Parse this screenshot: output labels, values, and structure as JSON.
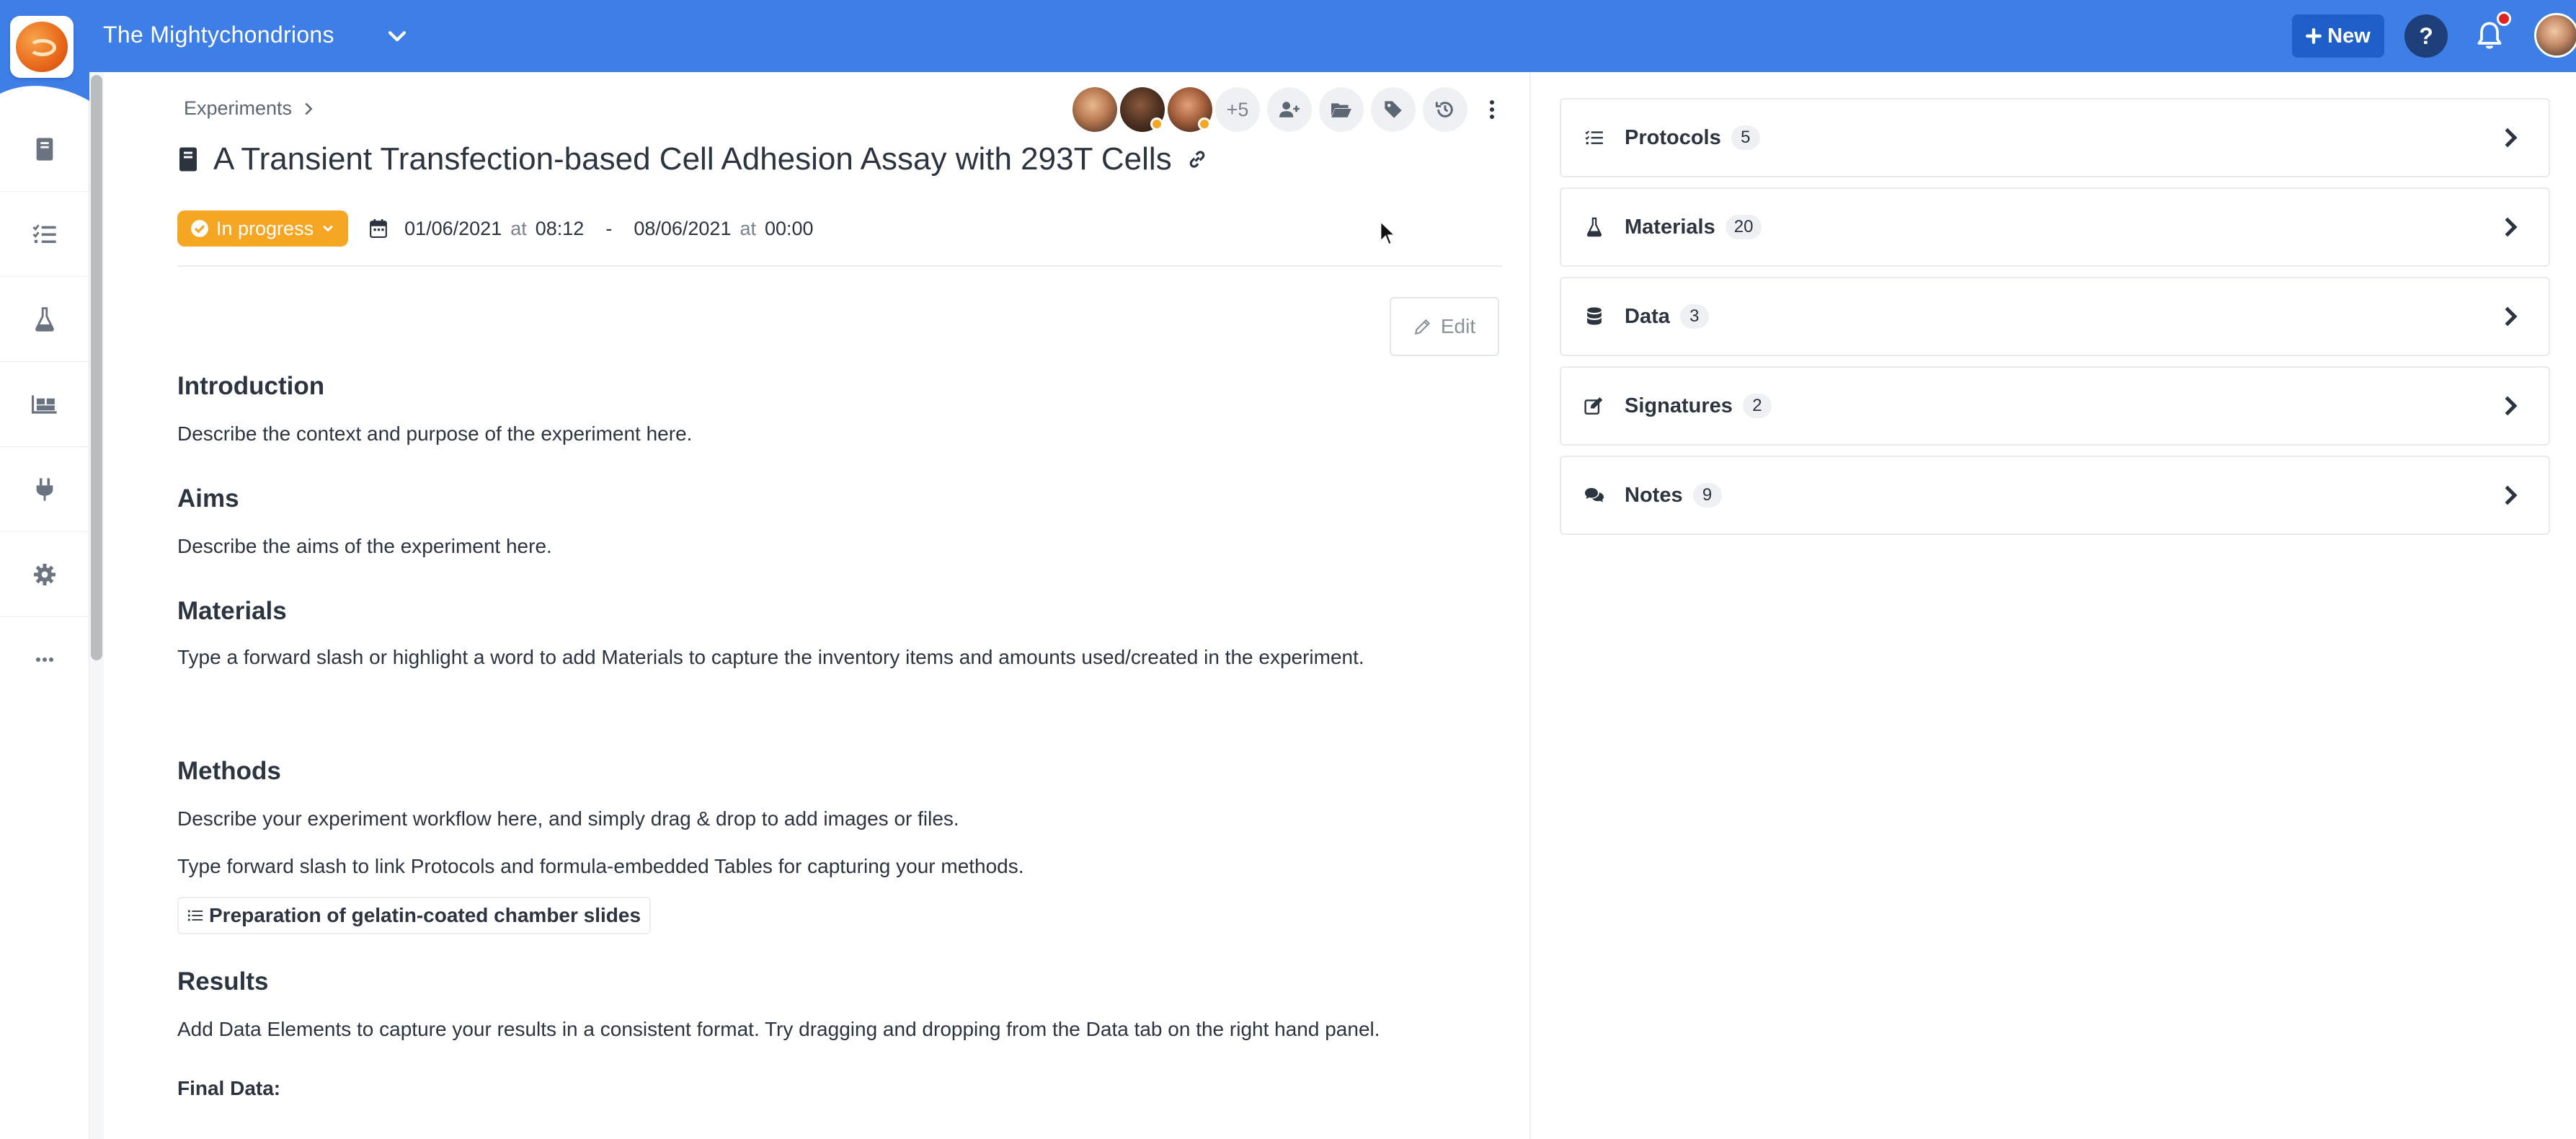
{
  "app": {
    "workspace_name": "The Mightychondrions",
    "new_button_label": "New",
    "help_label": "?"
  },
  "nav": {
    "items": [
      "notebook-icon",
      "protocols-icon",
      "materials-icon",
      "inventory-icon",
      "integrations-icon",
      "settings-icon",
      "more-icon"
    ]
  },
  "experiment": {
    "breadcrumb": "Experiments",
    "title": "A Transient Transfection-based Cell Adhesion Assay with 293T Cells",
    "status": "In progress",
    "start_date": "01/06/2021",
    "start_time": "08:12",
    "end_date": "08/06/2021",
    "end_time": "00:00",
    "at_label": "at",
    "range_separator": "-",
    "collaborators_more": "+5",
    "edit_label": "Edit"
  },
  "document": {
    "sections": [
      {
        "heading": "Introduction",
        "paragraphs": [
          "Describe the context and purpose of the experiment here."
        ]
      },
      {
        "heading": "Aims",
        "paragraphs": [
          "Describe the aims of the experiment here."
        ]
      },
      {
        "heading": "Materials",
        "paragraphs": [
          "Type a forward slash or highlight a word to add Materials to capture the inventory items and amounts used/created in the experiment."
        ]
      },
      {
        "heading": "Methods",
        "paragraphs": [
          "Describe your experiment workflow here, and simply drag & drop to add images or files.",
          "Type forward slash to link Protocols and formula-embedded Tables for capturing your methods."
        ]
      },
      {
        "heading": "Results",
        "paragraphs": [
          "Add Data Elements to capture your results in a consistent format. Try dragging and dropping from the Data tab on the right hand panel."
        ]
      }
    ],
    "linked_protocol": "Preparation of gelatin-coated chamber slides",
    "final_data_label": "Final Data:"
  },
  "panel": {
    "cards": [
      {
        "label": "Protocols",
        "count": "5",
        "icon": "list-icon"
      },
      {
        "label": "Materials",
        "count": "20",
        "icon": "flask-icon"
      },
      {
        "label": "Data",
        "count": "3",
        "icon": "database-icon"
      },
      {
        "label": "Signatures",
        "count": "2",
        "icon": "signature-icon"
      },
      {
        "label": "Notes",
        "count": "9",
        "icon": "comments-icon"
      }
    ]
  },
  "colors": {
    "topbar": "#3d7fe6",
    "new_button": "#1e5fc9",
    "status": "#f5a623",
    "text": "#2c3440"
  }
}
